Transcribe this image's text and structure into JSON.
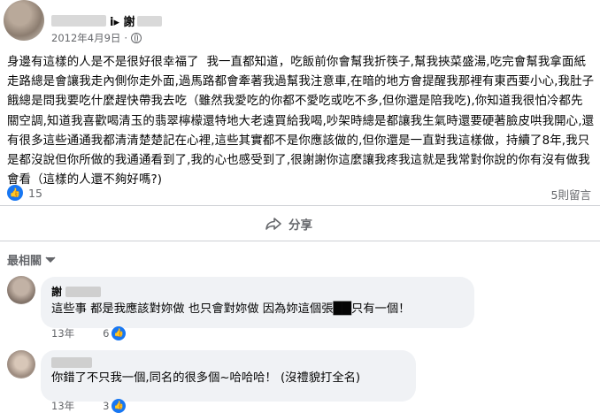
{
  "post": {
    "author_name": "i▸ 謝",
    "date": "2012年4月9日",
    "text": "身邊有這樣的人是不是很好很幸福了  我一直都知道，吃飯前你會幫我折筷子,幫我挾菜盛湯,吃完會幫我拿面紙走路總是會讓我走內側你走外面,過馬路都會牽著我過幫我注意車,在暗的地方會提醒我那裡有東西要小心,我肚子餓總是問我要吃什麼趕快帶我去吃（雖然我愛吃的你都不愛吃或吃不多,但你還是陪我吃),你知道我很怕冷都先關空調,知道我喜歡喝清玉的翡翠檸檬還特地大老遠買給我喝,吵架時總是都讓我生氣時還要硬著臉皮哄我開心,還有很多這些通通我都清清楚楚記在心裡,這些其實都不是你應該做的,但你還是一直對我這樣做，持續了8年,我只是都沒說但你所做的我通通看到了,我的心也感受到了,很謝謝你這麼讓我疼我這就是我常對你說的你有沒有做我會看（這樣的人還不夠好嗎?)",
    "reaction_count": "15",
    "comment_count": "5則留言",
    "share_label": "分享"
  },
  "comments_section": {
    "sort_label": "最相關"
  },
  "comments": [
    {
      "author": "謝",
      "text": "這些事 都是我應該對妳做 也只會對妳做 因為妳這個張██只有一個！",
      "time": "13年",
      "likes": "6"
    },
    {
      "author": "",
      "text": "你錯了不只我一個,同名的很多個~哈哈哈！  (沒禮貌打全名)",
      "time": "13年",
      "likes": "3"
    }
  ],
  "colors": {
    "accent": "#1877f2",
    "bubble": "#f0f2f5",
    "secondary_text": "#65676b"
  }
}
